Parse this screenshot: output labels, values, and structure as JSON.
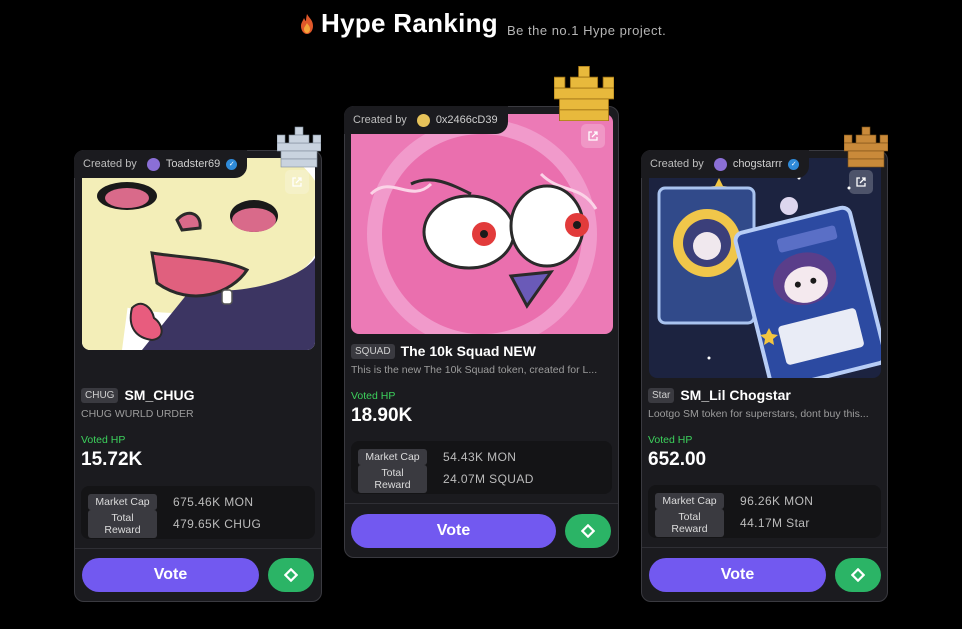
{
  "header": {
    "title": "Hype Ranking",
    "subtitle": "Be the no.1 Hype project.",
    "icon": "flame-icon"
  },
  "labels": {
    "created_by": "Created by",
    "voted_hp": "Voted HP",
    "market_cap": "Market Cap",
    "total_reward": "Total Reward",
    "vote": "Vote"
  },
  "colors": {
    "background": "#000000",
    "card": "#1b1b1f",
    "accent_vote": "#7259f0",
    "accent_share": "#2bb466",
    "voted_green": "#3cd15c",
    "crown_gold": "#e8b93c",
    "crown_silver": "#c9d3df",
    "crown_bronze": "#c98a3a"
  },
  "cards": [
    {
      "rank": 2,
      "crown": "silver-crown-icon",
      "creator": "Toadster69",
      "ticker": "CHUG",
      "name": "SM_CHUG",
      "description": "CHUG WURLD URDER",
      "voted_hp": "15.72K",
      "market_cap": "675.46K MON",
      "total_reward": "479.65K CHUG"
    },
    {
      "rank": 1,
      "crown": "gold-crown-icon",
      "creator": "0x2466cD39",
      "ticker": "SQUAD",
      "name": "The 10k Squad NEW",
      "description": "This is the new The 10k Squad token, created for L...",
      "voted_hp": "18.90K",
      "market_cap": "54.43K MON",
      "total_reward": "24.07M SQUAD"
    },
    {
      "rank": 3,
      "crown": "bronze-crown-icon",
      "creator": "chogstarrr",
      "ticker": "Star",
      "name": "SM_Lil Chogstar",
      "description": "Lootgo SM token for superstars, dont buy this...",
      "voted_hp": "652.00",
      "market_cap": "96.26K MON",
      "total_reward": "44.17M Star"
    }
  ]
}
